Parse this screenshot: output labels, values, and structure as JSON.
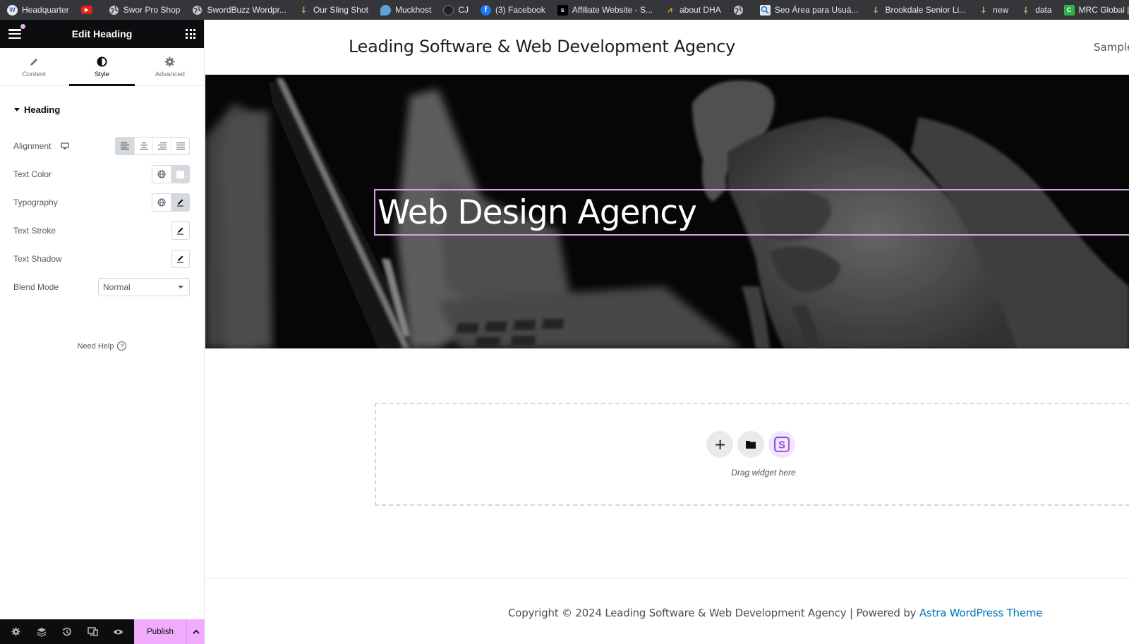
{
  "bookmarks": [
    {
      "label": "Headquarter",
      "icon": "wordpress-icon",
      "color": "#3a6ea5",
      "glyph": "W"
    },
    {
      "label": "",
      "icon": "youtube-icon",
      "color": "#e62117",
      "glyph": "▶"
    },
    {
      "label": "Swor Pro Shop",
      "icon": "globe-icon",
      "color": "#9aa0a6",
      "glyph": ""
    },
    {
      "label": "SwordBuzz Wordpr...",
      "icon": "globe-icon",
      "color": "#9aa0a6",
      "glyph": ""
    },
    {
      "label": "Our Sling Shot",
      "icon": "slingshot-icon",
      "color": "transparent",
      "glyph": "ᛘ"
    },
    {
      "label": "Muckhost",
      "icon": "muckhost-icon",
      "color": "#5ba3d9",
      "glyph": ""
    },
    {
      "label": "CJ",
      "icon": "cj-icon",
      "color": "#222",
      "glyph": "⊙"
    },
    {
      "label": "(3) Facebook",
      "icon": "facebook-icon",
      "color": "#1877f2",
      "glyph": "f"
    },
    {
      "label": "Affiliate Website - S...",
      "icon": "affiliate-icon",
      "color": "#000",
      "glyph": "s"
    },
    {
      "label": "about DHA",
      "icon": "dha-icon",
      "color": "transparent",
      "glyph": "ᨓ"
    },
    {
      "label": "",
      "icon": "globe-icon",
      "color": "#9aa0a6",
      "glyph": ""
    },
    {
      "label": "Seo Área para Usuá...",
      "icon": "seo-icon",
      "color": "#dfe8f5",
      "glyph": "🔍"
    },
    {
      "label": "Brookdale Senior Li...",
      "icon": "brookdale-icon",
      "color": "transparent",
      "glyph": "ᚠ"
    },
    {
      "label": "new",
      "icon": "new-icon",
      "color": "transparent",
      "glyph": "ᚠ"
    },
    {
      "label": "data",
      "icon": "data-icon",
      "color": "transparent",
      "glyph": "ᚠ"
    },
    {
      "label": "MRC Global | Jobs,...",
      "icon": "mrc-icon",
      "color": "#2db34a",
      "glyph": "C"
    }
  ],
  "panel": {
    "title": "Edit Heading",
    "tabs": [
      {
        "label": "Content",
        "icon": "pencil-icon",
        "active": false
      },
      {
        "label": "Style",
        "icon": "half-circle-icon",
        "active": true
      },
      {
        "label": "Advanced",
        "icon": "gear-icon",
        "active": false
      }
    ],
    "section": "Heading",
    "controls": {
      "alignment": "Alignment",
      "text_color": "Text Color",
      "typography": "Typography",
      "text_stroke": "Text Stroke",
      "text_shadow": "Text Shadow",
      "blend_mode": "Blend Mode",
      "blend_mode_value": "Normal"
    },
    "alignment_selected": "left",
    "need_help": "Need Help",
    "publish": "Publish"
  },
  "accent_color": "#f0abfc",
  "preview": {
    "site_title": "Leading Software & Web Development Agency",
    "nav_item": "Sample",
    "hero_heading": "Web Design Agency",
    "drop_zone_text": "Drag widget here",
    "copyright_prefix": "Copyright © 2024 Leading Software & Web Development Agency | Powered by ",
    "copyright_link": "Astra WordPress Theme"
  }
}
